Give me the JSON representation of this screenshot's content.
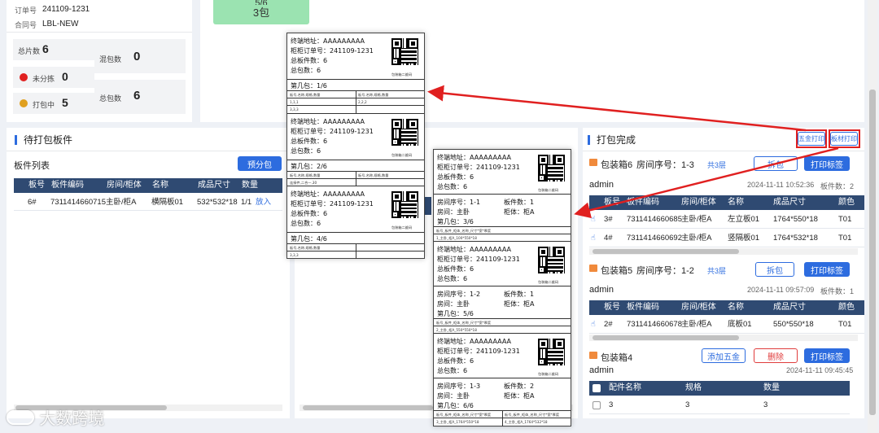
{
  "order_info": {
    "order_no_label": "订单号",
    "order_no": "241109-1231",
    "contract_label": "合同号",
    "contract": "LBL-NEW"
  },
  "stats": {
    "total_pieces_label": "总片数",
    "total_pieces": "6",
    "mixed_label": "混包数",
    "mixed": "0",
    "unsorted_label": "未分拣",
    "unsorted": "0",
    "packing_label": "打包中",
    "packing": "5",
    "total_packs_label": "总包数",
    "total_packs": "6",
    "status_colors": {
      "unsorted": "#e02020",
      "packing": "#e0a020"
    }
  },
  "progress_box": {
    "line1": "5/6",
    "line2": "3包"
  },
  "pending": {
    "title": "待打包板件",
    "list_title": "板件列表",
    "pre_pack_button": "预分包",
    "columns": [
      "板号",
      "板件编码",
      "房间/柜体",
      "名称",
      "成品尺寸",
      "数量"
    ],
    "rows": [
      {
        "no": "6#",
        "code": "7311414660715",
        "room": "主卧/柜A",
        "name": "横隔板01",
        "size": "532*532*18",
        "qty": "1/1",
        "action": "放入"
      }
    ]
  },
  "done": {
    "title": "打包完成",
    "hardware_print": "五金打印",
    "board_print": "板材打印",
    "packs": [
      {
        "name": "包装箱6",
        "room_seq": "房间序号：1-3",
        "layers": "共3层",
        "split": "拆包",
        "print": "打印标签",
        "user": "admin",
        "time": "2024-11-11 10:52:36",
        "count": "板件数：2",
        "columns": [
          "板号",
          "板件编码",
          "房间/柜体",
          "名称",
          "成品尺寸",
          "颜色"
        ],
        "rows": [
          {
            "no": "3#",
            "code": "7311414660685",
            "room": "主卧/柜A",
            "name": "左立板01",
            "size": "1764*550*18",
            "color": "T01"
          },
          {
            "no": "4#",
            "code": "7311414660692",
            "room": "主卧/柜A",
            "name": "竖隔板01",
            "size": "1764*532*18",
            "color": "T01"
          }
        ]
      },
      {
        "name": "包装箱5",
        "room_seq": "房间序号：1-2",
        "layers": "共3层",
        "split": "拆包",
        "print": "打印标签",
        "user": "admin",
        "time": "2024-11-11 09:57:09",
        "count": "板件数：1",
        "columns": [
          "板号",
          "板件编码",
          "房间/柜体",
          "名称",
          "成品尺寸",
          "颜色"
        ],
        "rows": [
          {
            "no": "2#",
            "code": "7311414660678",
            "room": "主卧/柜A",
            "name": "底板01",
            "size": "550*550*18",
            "color": "T01"
          }
        ]
      },
      {
        "name": "包装箱4",
        "add_hw": "添加五金",
        "delete": "删除",
        "print": "打印标签",
        "user": "admin",
        "time": "2024-11-11 09:45:45",
        "columns": [
          "配件名称",
          "规格",
          "数量"
        ],
        "rows": [
          {
            "name": "3",
            "spec": "3",
            "qty": "3"
          }
        ]
      }
    ]
  },
  "hw_labels": {
    "blocks": [
      {
        "addr": "终端地址：AAAAAAAAA",
        "order": "柜柜订单号：241109-1231",
        "boards": "总板件数：6",
        "packs": "总包数：6",
        "qr": "包装箱二维码",
        "nth": "第几包：1/6",
        "h1": "板号,名称,规格,数量",
        "h2": "板号,名称,规格,数量",
        "c1": "1,1,1",
        "c2": "2,2,2",
        "c3": "3,3,3"
      },
      {
        "addr": "终端地址：AAAAAAAAA",
        "order": "柜柜订单号：241109-1231",
        "boards": "总板件数：6",
        "packs": "总包数：6",
        "qr": "包装箱二维码",
        "nth": "第几包：2/6",
        "h1": "板号,名称,规格,数量",
        "h2": "板号,名称,规格,数量",
        "c1": "连接件,二合一,30"
      },
      {
        "addr": "终端地址：AAAAAAAAA",
        "order": "柜柜订单号：241109-1231",
        "boards": "总板件数：6",
        "packs": "总包数：6",
        "qr": "包装箱二维码",
        "nth": "第几包：4/6",
        "h1": "板号,名称,规格,数量",
        "c1": "3,3,3"
      }
    ]
  },
  "board_labels": {
    "blocks": [
      {
        "addr": "终端地址：AAAAAAAAA",
        "order": "柜柜订单号：241109-1231",
        "boards": "总板件数：6",
        "packs": "总包数：6",
        "qr": "包装箱二维码",
        "room_seq": "房间序号：1-1",
        "board_cnt": "板件数：1",
        "room": "房间：主卧",
        "cab": "柜体：柜A",
        "nth": "第几包：3/6",
        "h1": "板号_板件_柜体_名称_尺寸*宽*厚度",
        "c1": "1_主卧_柜A_100*550*18"
      },
      {
        "addr": "终端地址：AAAAAAAAA",
        "order": "柜柜订单号：241109-1231",
        "boards": "总板件数：6",
        "packs": "总包数：6",
        "qr": "包装箱二维码",
        "room_seq": "房间序号：1-2",
        "board_cnt": "板件数：1",
        "room": "房间：主卧",
        "cab": "柜体：柜A",
        "nth": "第几包：5/6",
        "h1": "板号_板件_柜体_名称_尺寸*宽*厚度",
        "c1": "2_主卧_柜A_550*550*18"
      },
      {
        "addr": "终端地址：AAAAAAAAA",
        "order": "柜柜订单号：241109-1231",
        "boards": "总板件数：6",
        "packs": "总包数：6",
        "qr": "包装箱二维码",
        "room_seq": "房间序号：1-3",
        "board_cnt": "板件数：2",
        "room": "房间：主卧",
        "cab": "柜体：柜A",
        "nth": "第几包：6/6",
        "h1": "板号_板件_柜体_名称_尺寸*宽*厚度",
        "h2": "板号_板件_柜体_名称_尺寸*宽*厚度",
        "c1": "3_主卧_柜A_1764*550*18",
        "c2": "4_主卧_柜A_1764*532*18"
      }
    ]
  },
  "watermark": "大数跨境",
  "accent": "#2d6cdf",
  "annotation_color": "#e02020"
}
